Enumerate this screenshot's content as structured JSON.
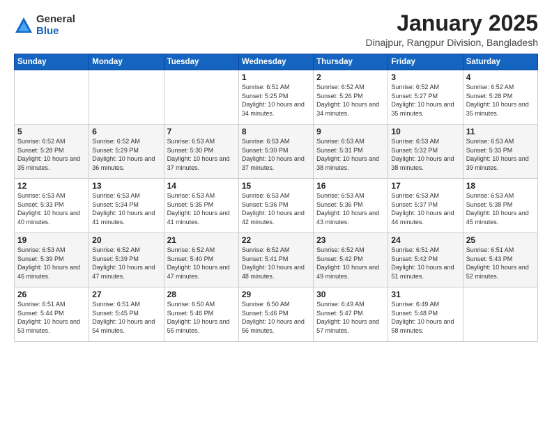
{
  "logo": {
    "general": "General",
    "blue": "Blue"
  },
  "title": "January 2025",
  "location": "Dinajpur, Rangpur Division, Bangladesh",
  "days_of_week": [
    "Sunday",
    "Monday",
    "Tuesday",
    "Wednesday",
    "Thursday",
    "Friday",
    "Saturday"
  ],
  "weeks": [
    [
      {
        "day": "",
        "info": ""
      },
      {
        "day": "",
        "info": ""
      },
      {
        "day": "",
        "info": ""
      },
      {
        "day": "1",
        "info": "Sunrise: 6:51 AM\nSunset: 5:25 PM\nDaylight: 10 hours\nand 34 minutes."
      },
      {
        "day": "2",
        "info": "Sunrise: 6:52 AM\nSunset: 5:26 PM\nDaylight: 10 hours\nand 34 minutes."
      },
      {
        "day": "3",
        "info": "Sunrise: 6:52 AM\nSunset: 5:27 PM\nDaylight: 10 hours\nand 35 minutes."
      },
      {
        "day": "4",
        "info": "Sunrise: 6:52 AM\nSunset: 5:28 PM\nDaylight: 10 hours\nand 35 minutes."
      }
    ],
    [
      {
        "day": "5",
        "info": "Sunrise: 6:52 AM\nSunset: 5:28 PM\nDaylight: 10 hours\nand 35 minutes."
      },
      {
        "day": "6",
        "info": "Sunrise: 6:52 AM\nSunset: 5:29 PM\nDaylight: 10 hours\nand 36 minutes."
      },
      {
        "day": "7",
        "info": "Sunrise: 6:53 AM\nSunset: 5:30 PM\nDaylight: 10 hours\nand 37 minutes."
      },
      {
        "day": "8",
        "info": "Sunrise: 6:53 AM\nSunset: 5:30 PM\nDaylight: 10 hours\nand 37 minutes."
      },
      {
        "day": "9",
        "info": "Sunrise: 6:53 AM\nSunset: 5:31 PM\nDaylight: 10 hours\nand 38 minutes."
      },
      {
        "day": "10",
        "info": "Sunrise: 6:53 AM\nSunset: 5:32 PM\nDaylight: 10 hours\nand 38 minutes."
      },
      {
        "day": "11",
        "info": "Sunrise: 6:53 AM\nSunset: 5:33 PM\nDaylight: 10 hours\nand 39 minutes."
      }
    ],
    [
      {
        "day": "12",
        "info": "Sunrise: 6:53 AM\nSunset: 5:33 PM\nDaylight: 10 hours\nand 40 minutes."
      },
      {
        "day": "13",
        "info": "Sunrise: 6:53 AM\nSunset: 5:34 PM\nDaylight: 10 hours\nand 41 minutes."
      },
      {
        "day": "14",
        "info": "Sunrise: 6:53 AM\nSunset: 5:35 PM\nDaylight: 10 hours\nand 41 minutes."
      },
      {
        "day": "15",
        "info": "Sunrise: 6:53 AM\nSunset: 5:36 PM\nDaylight: 10 hours\nand 42 minutes."
      },
      {
        "day": "16",
        "info": "Sunrise: 6:53 AM\nSunset: 5:36 PM\nDaylight: 10 hours\nand 43 minutes."
      },
      {
        "day": "17",
        "info": "Sunrise: 6:53 AM\nSunset: 5:37 PM\nDaylight: 10 hours\nand 44 minutes."
      },
      {
        "day": "18",
        "info": "Sunrise: 6:53 AM\nSunset: 5:38 PM\nDaylight: 10 hours\nand 45 minutes."
      }
    ],
    [
      {
        "day": "19",
        "info": "Sunrise: 6:53 AM\nSunset: 5:39 PM\nDaylight: 10 hours\nand 46 minutes."
      },
      {
        "day": "20",
        "info": "Sunrise: 6:52 AM\nSunset: 5:39 PM\nDaylight: 10 hours\nand 47 minutes."
      },
      {
        "day": "21",
        "info": "Sunrise: 6:52 AM\nSunset: 5:40 PM\nDaylight: 10 hours\nand 47 minutes."
      },
      {
        "day": "22",
        "info": "Sunrise: 6:52 AM\nSunset: 5:41 PM\nDaylight: 10 hours\nand 48 minutes."
      },
      {
        "day": "23",
        "info": "Sunrise: 6:52 AM\nSunset: 5:42 PM\nDaylight: 10 hours\nand 49 minutes."
      },
      {
        "day": "24",
        "info": "Sunrise: 6:51 AM\nSunset: 5:42 PM\nDaylight: 10 hours\nand 51 minutes."
      },
      {
        "day": "25",
        "info": "Sunrise: 6:51 AM\nSunset: 5:43 PM\nDaylight: 10 hours\nand 52 minutes."
      }
    ],
    [
      {
        "day": "26",
        "info": "Sunrise: 6:51 AM\nSunset: 5:44 PM\nDaylight: 10 hours\nand 53 minutes."
      },
      {
        "day": "27",
        "info": "Sunrise: 6:51 AM\nSunset: 5:45 PM\nDaylight: 10 hours\nand 54 minutes."
      },
      {
        "day": "28",
        "info": "Sunrise: 6:50 AM\nSunset: 5:46 PM\nDaylight: 10 hours\nand 55 minutes."
      },
      {
        "day": "29",
        "info": "Sunrise: 6:50 AM\nSunset: 5:46 PM\nDaylight: 10 hours\nand 56 minutes."
      },
      {
        "day": "30",
        "info": "Sunrise: 6:49 AM\nSunset: 5:47 PM\nDaylight: 10 hours\nand 57 minutes."
      },
      {
        "day": "31",
        "info": "Sunrise: 6:49 AM\nSunset: 5:48 PM\nDaylight: 10 hours\nand 58 minutes."
      },
      {
        "day": "",
        "info": ""
      }
    ]
  ]
}
